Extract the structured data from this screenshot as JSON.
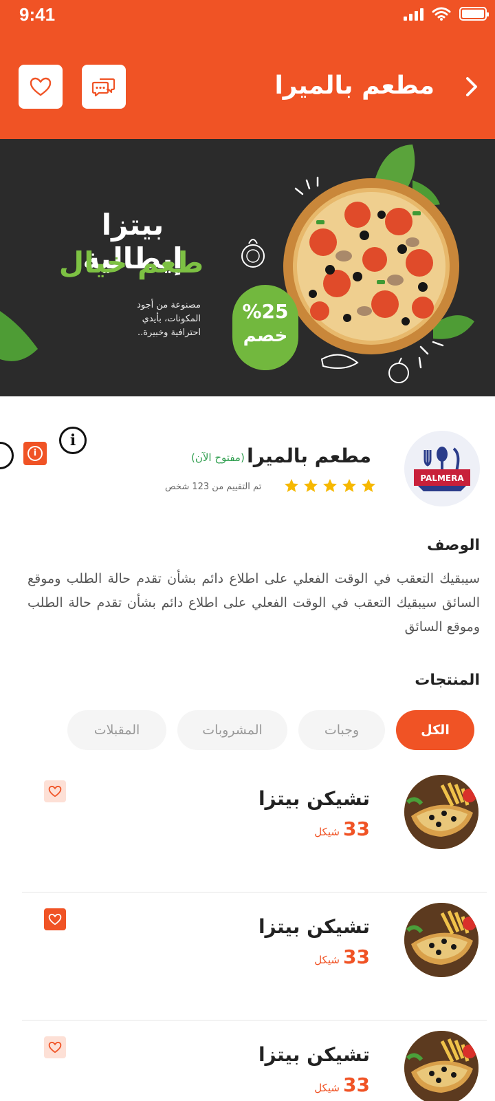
{
  "status": {
    "time": "9:41"
  },
  "header": {
    "title": "مطعم بالميرا"
  },
  "banner": {
    "title1": "بيتزا إيطالية",
    "title2": "طعم خيال",
    "subtitle": "مصنوعة من أجود المكونات، بأيدي احترافية وخبيرة..",
    "discount_pct": "%25",
    "discount_word": "خصم"
  },
  "restaurant": {
    "logo_text": "PALMERA",
    "name": "مطعم بالميرا",
    "open_status": "(مفتوح الآن)",
    "rating": 5,
    "rating_text": "تم التقييم من 123 شخص"
  },
  "description": {
    "title": "الوصف",
    "text": "سيبقيك التعقب في الوقت الفعلي على اطلاع دائم بشأن تقدم حالة الطلب وموقع السائق سيبقيك التعقب في الوقت الفعلي على اطلاع دائم بشأن تقدم حالة الطلب وموقع السائق"
  },
  "products": {
    "title": "المنتجات",
    "tabs": [
      {
        "label": "الكل",
        "active": true
      },
      {
        "label": "وجبات",
        "active": false
      },
      {
        "label": "المشروبات",
        "active": false
      },
      {
        "label": "المقبلات",
        "active": false
      }
    ],
    "items": [
      {
        "name": "تشيكن بيتزا",
        "price": "33",
        "currency": "شيكل",
        "favorite": false
      },
      {
        "name": "تشيكن بيتزا",
        "price": "33",
        "currency": "شيكل",
        "favorite": true
      },
      {
        "name": "تشيكن بيتزا",
        "price": "33",
        "currency": "شيكل",
        "favorite": false
      }
    ]
  },
  "colors": {
    "primary": "#f05325",
    "banner_bg": "#2b2b2b",
    "green": "#72b83e",
    "open_green": "#2e9e4e",
    "star": "#f6b800"
  }
}
